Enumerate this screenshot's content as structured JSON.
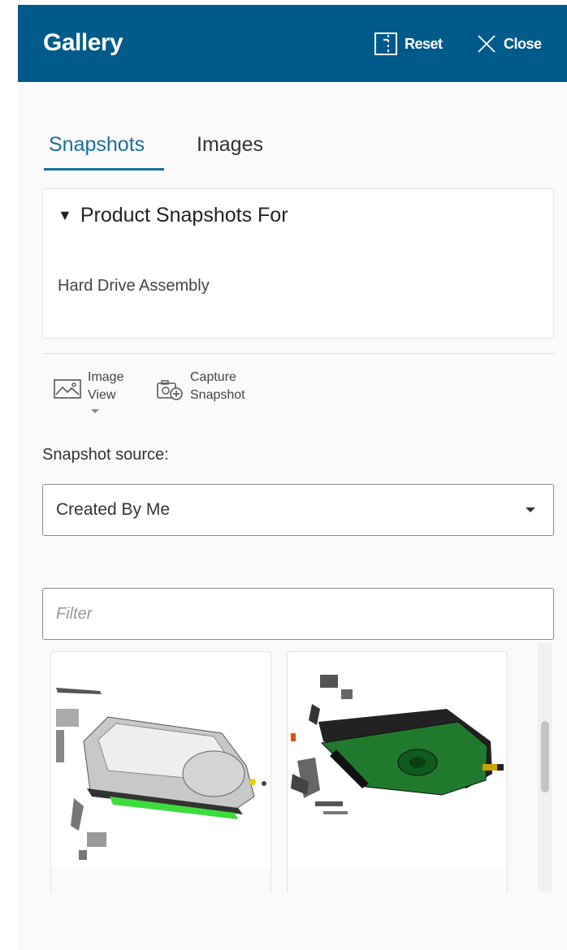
{
  "header": {
    "title": "Gallery",
    "reset_label": "Reset",
    "close_label": "Close",
    "bg_color": "#005a8a"
  },
  "tabs": [
    {
      "label": "Snapshots",
      "active": true
    },
    {
      "label": "Images",
      "active": false
    }
  ],
  "card": {
    "heading": "Product Snapshots For",
    "subtitle": "Hard Drive Assembly"
  },
  "toolbar": {
    "image_view_line1": "Image",
    "image_view_line2": "View",
    "capture_line1": "Capture",
    "capture_line2": "Snapshot"
  },
  "source": {
    "label": "Snapshot source:",
    "selected": "Created By Me"
  },
  "filter": {
    "placeholder": "Filter"
  },
  "snapshots": [
    {
      "icon": "hard-drive-exploded-top-view"
    },
    {
      "icon": "hard-drive-circuit-board-view"
    }
  ],
  "colors": {
    "accent": "#1b6e9e",
    "header": "#005a8a"
  }
}
